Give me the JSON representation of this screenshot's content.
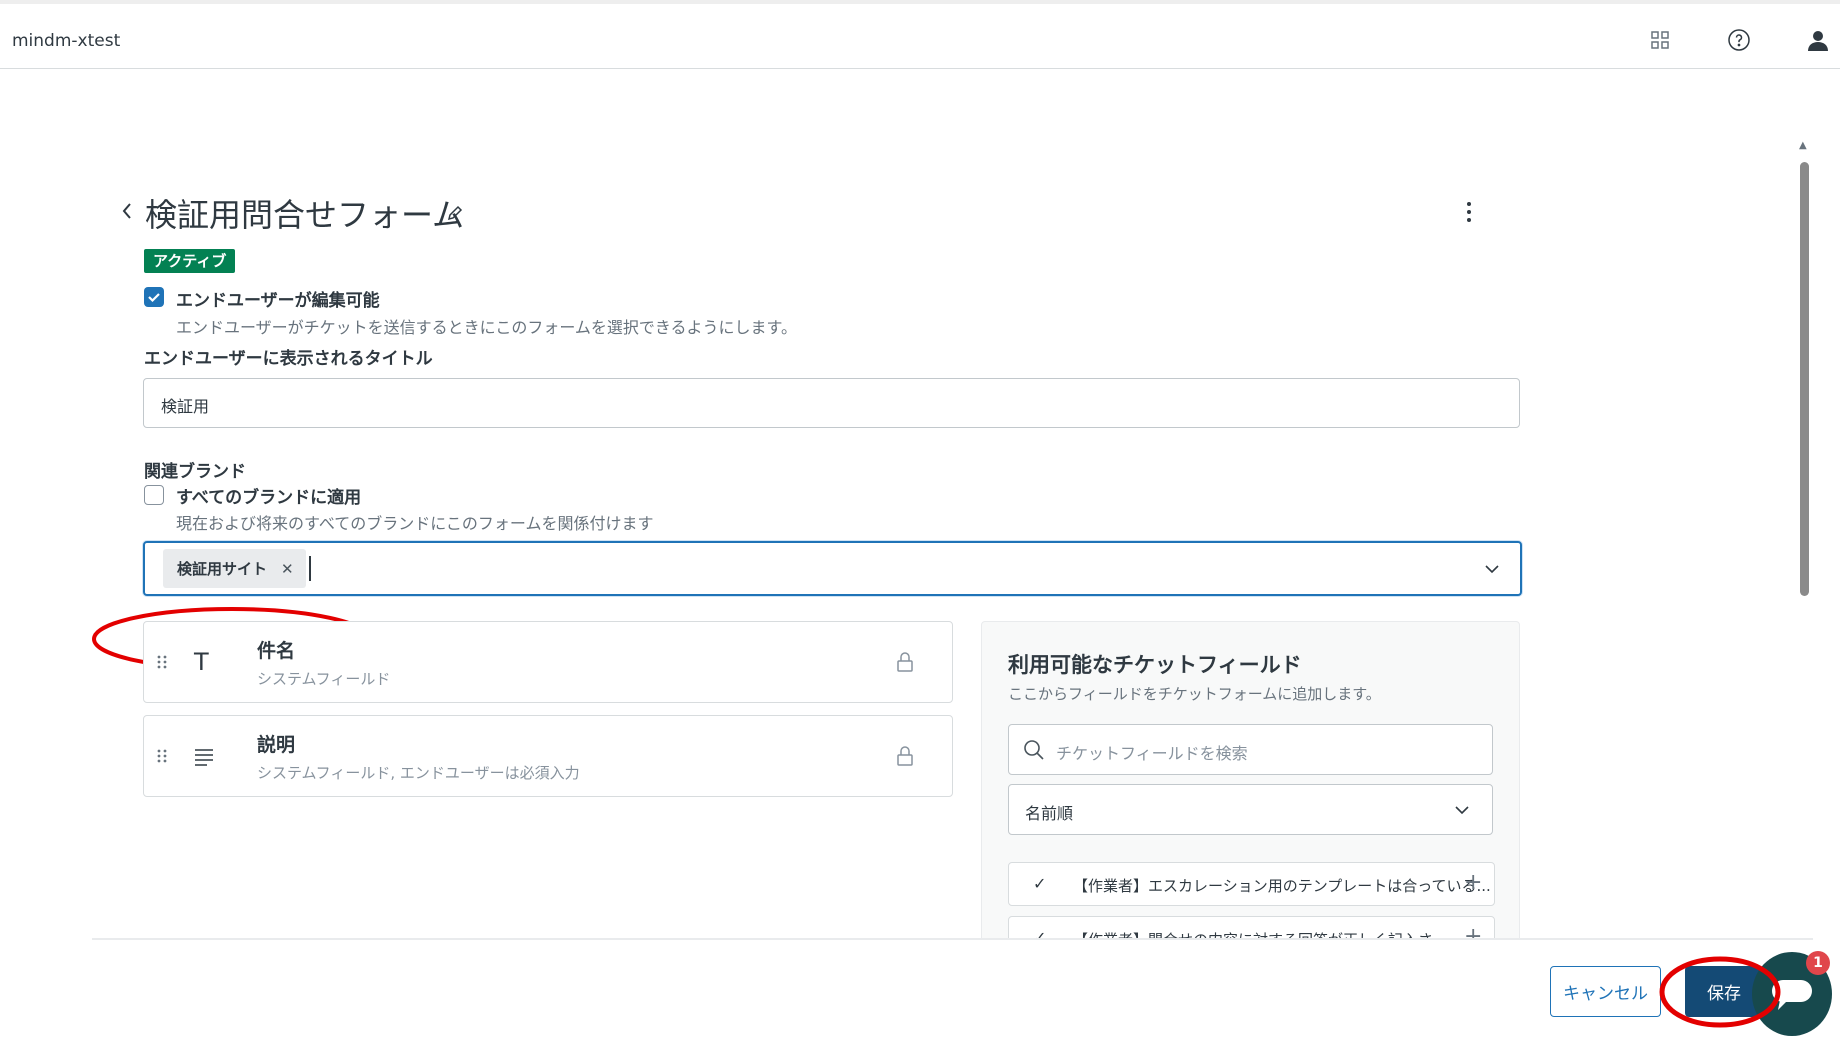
{
  "app": {
    "title": "mindm-xtest"
  },
  "header_icons": [
    "apps-grid-icon",
    "help-icon",
    "user-icon"
  ],
  "form": {
    "title": "検証用問合せフォーム",
    "status_badge": "アクティブ",
    "end_user_editable": {
      "label": "エンドユーザーが編集可能",
      "description": "エンドユーザーがチケットを送信するときにこのフォームを選択できるようにします。",
      "checked": true
    },
    "display_title": {
      "label": "エンドユーザーに表示されるタイトル",
      "value": "検証用"
    },
    "brands": {
      "label": "関連ブランド",
      "apply_all_label": "すべてのブランドに適用",
      "apply_all_checked": false,
      "apply_all_description": "現在および将来のすべてのブランドにこのフォームを関係付けます",
      "selected": [
        "検証用サイト"
      ]
    }
  },
  "form_fields": [
    {
      "name": "件名",
      "description": "システムフィールド",
      "icon": "text-icon"
    },
    {
      "name": "説明",
      "description": "システムフィールド, エンドユーザーは必須入力",
      "icon": "paragraph-icon"
    }
  ],
  "available_panel": {
    "title": "利用可能なチケットフィールド",
    "subtitle": "ここからフィールドをチケットフォームに追加します。",
    "search_placeholder": "チケットフィールドを検索",
    "sort": "名前順",
    "items": [
      "【作業者】エスカレーション用のテンプレートは合っている...",
      "【作業者】問合せの内容に対する回答が正しく記入さ..."
    ]
  },
  "footer": {
    "cancel": "キャンセル",
    "save": "保存"
  },
  "chat": {
    "badge": "1"
  },
  "colors": {
    "accent": "#1f73b7",
    "badge": "#038153",
    "save": "#17494d",
    "highlight": "#e30000"
  }
}
